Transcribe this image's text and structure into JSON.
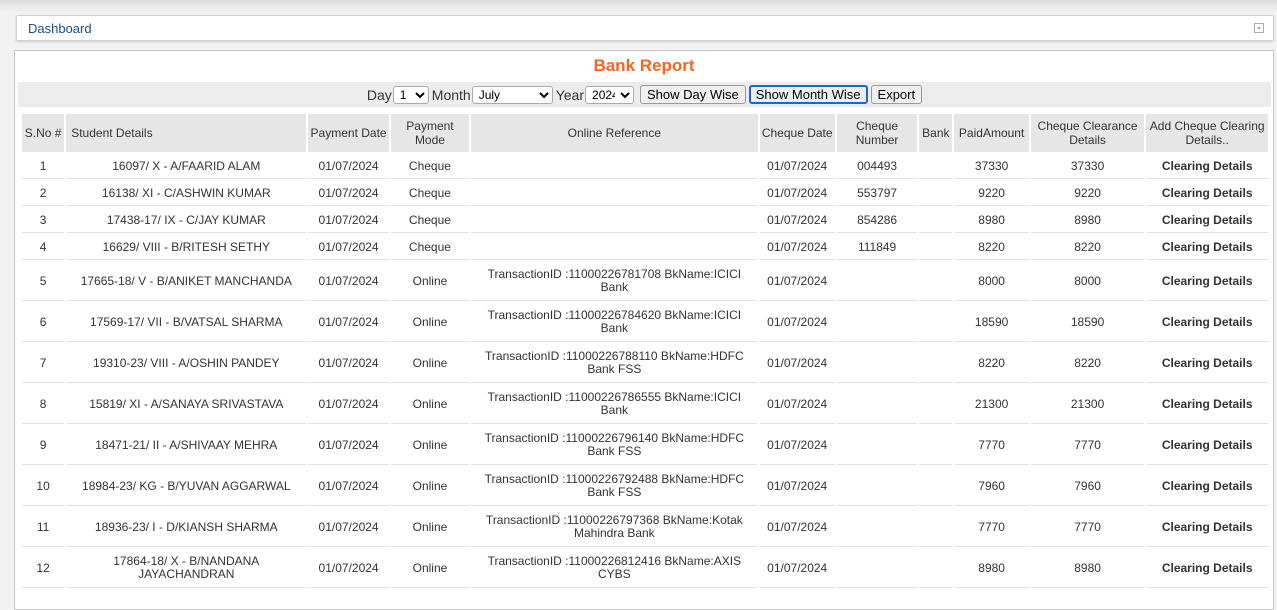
{
  "dashboard": {
    "link_label": "Dashboard"
  },
  "report": {
    "title": "Bank Report",
    "filters": {
      "day_label": "Day",
      "day_value": "1",
      "month_label": "Month",
      "month_value": "July",
      "year_label": "Year",
      "year_value": "2024",
      "show_day_wise": "Show Day Wise",
      "show_month_wise": "Show Month Wise",
      "export": "Export"
    },
    "columns": [
      "S.No #",
      "Student Details",
      "Payment Date",
      "Payment Mode",
      "Online Reference",
      "Cheque Date",
      "Cheque Number",
      "Bank",
      "PaidAmount",
      "Cheque Clearance Details",
      "Add Cheque Clearing Details.."
    ],
    "rows": [
      {
        "sno": "1",
        "student": "16097/ X - A/FAARID ALAM",
        "pay_date": "01/07/2024",
        "mode": "Cheque",
        "ref": "",
        "cheque_date": "01/07/2024",
        "cheque_no": "004493",
        "bank": "",
        "amount": "37330",
        "clearance": "37330",
        "action": "Clearing Details"
      },
      {
        "sno": "2",
        "student": "16138/ XI - C/ASHWIN KUMAR",
        "pay_date": "01/07/2024",
        "mode": "Cheque",
        "ref": "",
        "cheque_date": "01/07/2024",
        "cheque_no": "553797",
        "bank": "",
        "amount": "9220",
        "clearance": "9220",
        "action": "Clearing Details"
      },
      {
        "sno": "3",
        "student": "17438-17/ IX - C/JAY KUMAR",
        "pay_date": "01/07/2024",
        "mode": "Cheque",
        "ref": "",
        "cheque_date": "01/07/2024",
        "cheque_no": "854286",
        "bank": "",
        "amount": "8980",
        "clearance": "8980",
        "action": "Clearing Details"
      },
      {
        "sno": "4",
        "student": "16629/ VIII - B/RITESH SETHY",
        "pay_date": "01/07/2024",
        "mode": "Cheque",
        "ref": "",
        "cheque_date": "01/07/2024",
        "cheque_no": "111849",
        "bank": "",
        "amount": "8220",
        "clearance": "8220",
        "action": "Clearing Details"
      },
      {
        "sno": "5",
        "student": "17665-18/ V - B/ANIKET MANCHANDA",
        "pay_date": "01/07/2024",
        "mode": "Online",
        "ref": "TransactionID :11000226781708 BkName:ICICI Bank",
        "cheque_date": "01/07/2024",
        "cheque_no": "",
        "bank": "",
        "amount": "8000",
        "clearance": "8000",
        "action": "Clearing Details"
      },
      {
        "sno": "6",
        "student": "17569-17/ VII - B/VATSAL SHARMA",
        "pay_date": "01/07/2024",
        "mode": "Online",
        "ref": "TransactionID :11000226784620 BkName:ICICI Bank",
        "cheque_date": "01/07/2024",
        "cheque_no": "",
        "bank": "",
        "amount": "18590",
        "clearance": "18590",
        "action": "Clearing Details"
      },
      {
        "sno": "7",
        "student": "19310-23/ VIII - A/OSHIN PANDEY",
        "pay_date": "01/07/2024",
        "mode": "Online",
        "ref": "TransactionID :11000226788110 BkName:HDFC Bank FSS",
        "cheque_date": "01/07/2024",
        "cheque_no": "",
        "bank": "",
        "amount": "8220",
        "clearance": "8220",
        "action": "Clearing Details"
      },
      {
        "sno": "8",
        "student": "15819/ XI - A/SANAYA SRIVASTAVA",
        "pay_date": "01/07/2024",
        "mode": "Online",
        "ref": "TransactionID :11000226786555 BkName:ICICI Bank",
        "cheque_date": "01/07/2024",
        "cheque_no": "",
        "bank": "",
        "amount": "21300",
        "clearance": "21300",
        "action": "Clearing Details"
      },
      {
        "sno": "9",
        "student": "18471-21/ II - A/SHIVAAY MEHRA",
        "pay_date": "01/07/2024",
        "mode": "Online",
        "ref": "TransactionID :11000226796140 BkName:HDFC Bank FSS",
        "cheque_date": "01/07/2024",
        "cheque_no": "",
        "bank": "",
        "amount": "7770",
        "clearance": "7770",
        "action": "Clearing Details"
      },
      {
        "sno": "10",
        "student": "18984-23/ KG - B/YUVAN AGGARWAL",
        "pay_date": "01/07/2024",
        "mode": "Online",
        "ref": "TransactionID :11000226792488 BkName:HDFC Bank FSS",
        "cheque_date": "01/07/2024",
        "cheque_no": "",
        "bank": "",
        "amount": "7960",
        "clearance": "7960",
        "action": "Clearing Details"
      },
      {
        "sno": "11",
        "student": "18936-23/ I - D/KIANSH SHARMA",
        "pay_date": "01/07/2024",
        "mode": "Online",
        "ref": "TransactionID :11000226797368 BkName:Kotak Mahindra Bank",
        "cheque_date": "01/07/2024",
        "cheque_no": "",
        "bank": "",
        "amount": "7770",
        "clearance": "7770",
        "action": "Clearing Details"
      },
      {
        "sno": "12",
        "student": "17864-18/ X - B/NANDANA JAYACHANDRAN",
        "pay_date": "01/07/2024",
        "mode": "Online",
        "ref": "TransactionID :11000226812416 BkName:AXIS CYBS",
        "cheque_date": "01/07/2024",
        "cheque_no": "",
        "bank": "",
        "amount": "8980",
        "clearance": "8980",
        "action": "Clearing Details"
      }
    ]
  },
  "colors": {
    "title": "#f26522",
    "link": "#1e7b1e",
    "header_bg": "#e6e6e6",
    "dashboard_link": "#1a4f8a"
  }
}
